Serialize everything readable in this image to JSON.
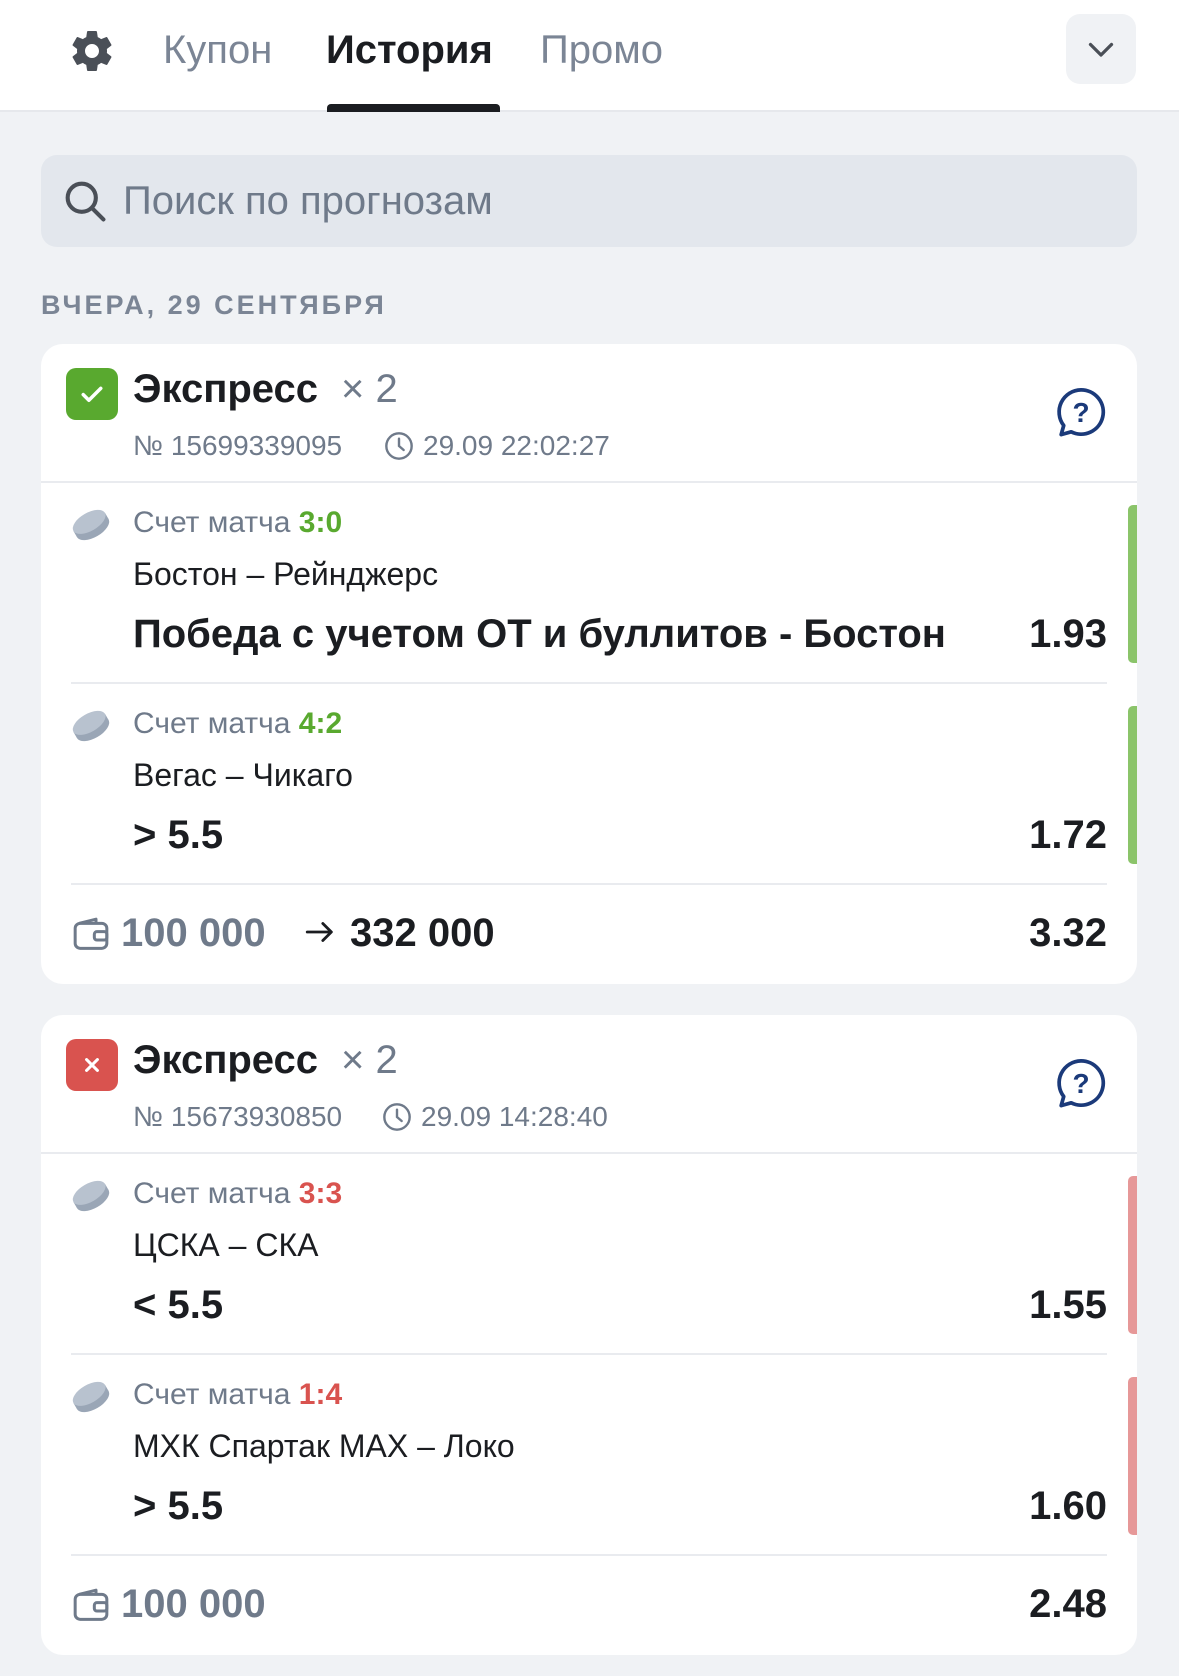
{
  "header": {
    "tabs": [
      {
        "label": "Купон",
        "active": false
      },
      {
        "label": "История",
        "active": true
      },
      {
        "label": "Промо",
        "active": false
      }
    ]
  },
  "search": {
    "placeholder": "Поиск по прогнозам"
  },
  "date_label": "ВЧЕРА, 29 СЕНТЯБРЯ",
  "colors": {
    "won": "#59a92f",
    "lost": "#d9534f",
    "accent": "#1b3a7a"
  },
  "bets": [
    {
      "status": "won",
      "type": "Экспресс",
      "multiplier": "× 2",
      "ticket": "№ 15699339095",
      "datetime": "29.09 22:02:27",
      "legs": [
        {
          "score_label": "Счет матча",
          "score": "3:0",
          "match": "Бостон – Рейнджерс",
          "outcome": "Победа с учетом ОТ и буллитов - Бостон",
          "odds": "1.93",
          "result": "won"
        },
        {
          "score_label": "Счет матча",
          "score": "4:2",
          "match": "Вегас – Чикаго",
          "outcome": "> 5.5",
          "odds": "1.72",
          "result": "won"
        }
      ],
      "stake": "100 000",
      "payout": "332 000",
      "total_odds": "3.32"
    },
    {
      "status": "lost",
      "type": "Экспресс",
      "multiplier": "× 2",
      "ticket": "№ 15673930850",
      "datetime": "29.09 14:28:40",
      "legs": [
        {
          "score_label": "Счет матча",
          "score": "3:3",
          "match": "ЦСКА – СКА",
          "outcome": "< 5.5",
          "odds": "1.55",
          "result": "lost"
        },
        {
          "score_label": "Счет матча",
          "score": "1:4",
          "match": "МХК Спартак МАХ – Локо",
          "outcome": "> 5.5",
          "odds": "1.60",
          "result": "lost"
        }
      ],
      "stake": "100 000",
      "payout": "",
      "total_odds": "2.48"
    }
  ]
}
